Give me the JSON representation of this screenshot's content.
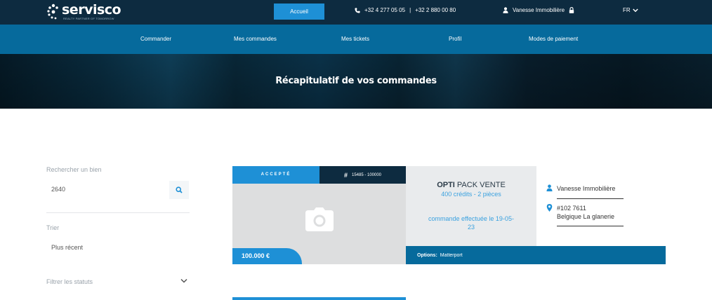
{
  "header": {
    "brand": "servisco",
    "tagline": "REALTY PARTNER OF TOMORROW",
    "home_button": "Accueil",
    "phone_1": "+32 4 277 05 05",
    "phone_separator": "|",
    "phone_2": "+32 2 880 00 80",
    "user_name": "Vanesse Immobilière",
    "language": "FR"
  },
  "nav": {
    "items": [
      "Commander",
      "Mes commandes",
      "Mes tickets",
      "Profil",
      "Modes de paiement"
    ]
  },
  "hero": {
    "title": "Récapitulatif de vos commandes"
  },
  "filters": {
    "search_label": "Rechercher un bien",
    "search_value": "2640",
    "sort_label": "Trier",
    "sort_value": "Plus récent",
    "status_label": "Filtrer les statuts"
  },
  "order": {
    "status": "ACCEPTÉ",
    "reference_prefix": "#",
    "reference": "15485 - 100000",
    "price": "100.000 €",
    "pack_name_bold": "OPTI",
    "pack_name_rest": " PACK VENTE",
    "pack_details": "400 crédits - 2 pièces",
    "order_date_text": "commande effectuée le 19-05-23",
    "options_label": "Options:",
    "options_value": "Matterport",
    "client": "Vanesse Immobilière",
    "address_line_1": "#102 7611",
    "address_line_2": "Belgique La glanerie"
  },
  "colors": {
    "top_bar": "#0d2b40",
    "nav_bar": "#066a9c",
    "accent": "#1e90d6",
    "light_blue_text": "#3aa1df"
  },
  "icons": [
    "logo-dots-icon",
    "phone-icon",
    "user-icon",
    "lock-icon",
    "chevron-down-icon",
    "search-icon",
    "camera-icon",
    "hash-icon",
    "location-pin-icon"
  ]
}
